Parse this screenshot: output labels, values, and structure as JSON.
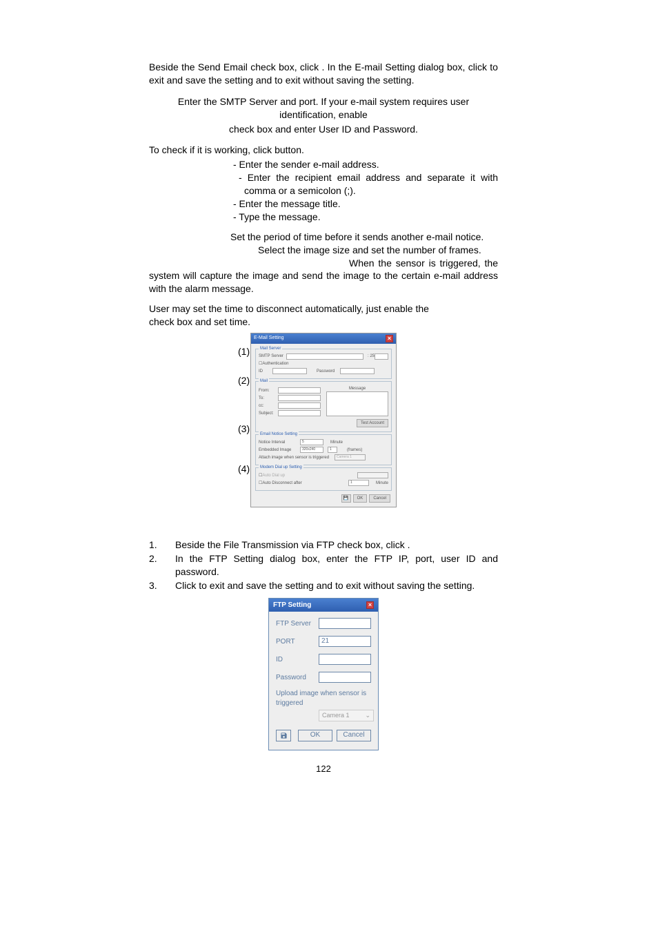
{
  "page_number": "122",
  "intro": {
    "p1a": "Beside the Send Email check box, click ",
    "p1b": ". In the E-mail Setting dialog box, click ",
    "p1c": " to exit and save the setting and ",
    "p1d": " to exit without saving the setting."
  },
  "section1": {
    "p1": "Enter the SMTP Server and port. If your e-mail system requires user identification, enable",
    "p2": "check box and enter User ID and Password."
  },
  "section2": {
    "p1a": "To check if it is working, click ",
    "p1b": " button.",
    "li1": "- Enter the sender e-mail address.",
    "li2": "- Enter the recipient email address and separate it with comma or a semicolon (;).",
    "li3": "- Enter the message title.",
    "li4": "- Type the message."
  },
  "section3": {
    "p1": "Set the period of time before it sends another e-mail notice.",
    "p2": "Select the image size and set the number of frames.",
    "p3": "When the sensor is triggered, the system will capture the image and send the image to the certain e-mail address with the alarm message."
  },
  "section4": {
    "p1": "User may set the time to disconnect automatically, just enable the",
    "p2": "check box and set time."
  },
  "ftp_steps": {
    "s1num": "1.",
    "s1": "Beside the File Transmission via FTP check box, click ",
    "s1end": ".",
    "s2num": "2.",
    "s2": "In the FTP Setting dialog box, enter the FTP IP, port, user ID and password.",
    "s3num": "3.",
    "s3a": "Click ",
    "s3b": " to exit and save the setting and ",
    "s3c": " to exit without saving the setting."
  },
  "email_dialog": {
    "title": "E-Mail Setting",
    "mail_server": "Mail Server",
    "smtp_server": "SMTP Server",
    "port_val": ": 25",
    "auth": "Authentication",
    "id": "ID",
    "password": "Password",
    "mail": "Mail",
    "message": "Message",
    "from": "From:",
    "to": "To:",
    "cc": "cc:",
    "subject": "Subject:",
    "test": "Test Account",
    "email_notice": "Email Notice Setting",
    "notice_interval": "Notice Interval",
    "notice_val": "5",
    "minute": "Minute",
    "embedded": "Embedded Image",
    "embedded_val": "320x240",
    "frames_val": "1",
    "frames": "(frames)",
    "attach": "Attach image when sensor is triggered",
    "camera1": "Camera 1",
    "modem": "Modem Dial up Setting",
    "auto_dial": "Auto Dial up",
    "auto_disc": "Auto Disconnect after",
    "disc_val": "1",
    "disc_min": "Minute",
    "ok": "OK",
    "cancel": "Cancel"
  },
  "ftp_dialog": {
    "title": "FTP Setting",
    "server": "FTP Server",
    "port": "PORT",
    "port_val": "21",
    "id": "ID",
    "password": "Password",
    "upload_text": "Upload image when sensor is triggered",
    "camera": "Camera 1",
    "ok": "OK",
    "cancel": "Cancel"
  },
  "markers": {
    "m1": "(1)",
    "m2": "(2)",
    "m3": "(3)",
    "m4": "(4)"
  }
}
